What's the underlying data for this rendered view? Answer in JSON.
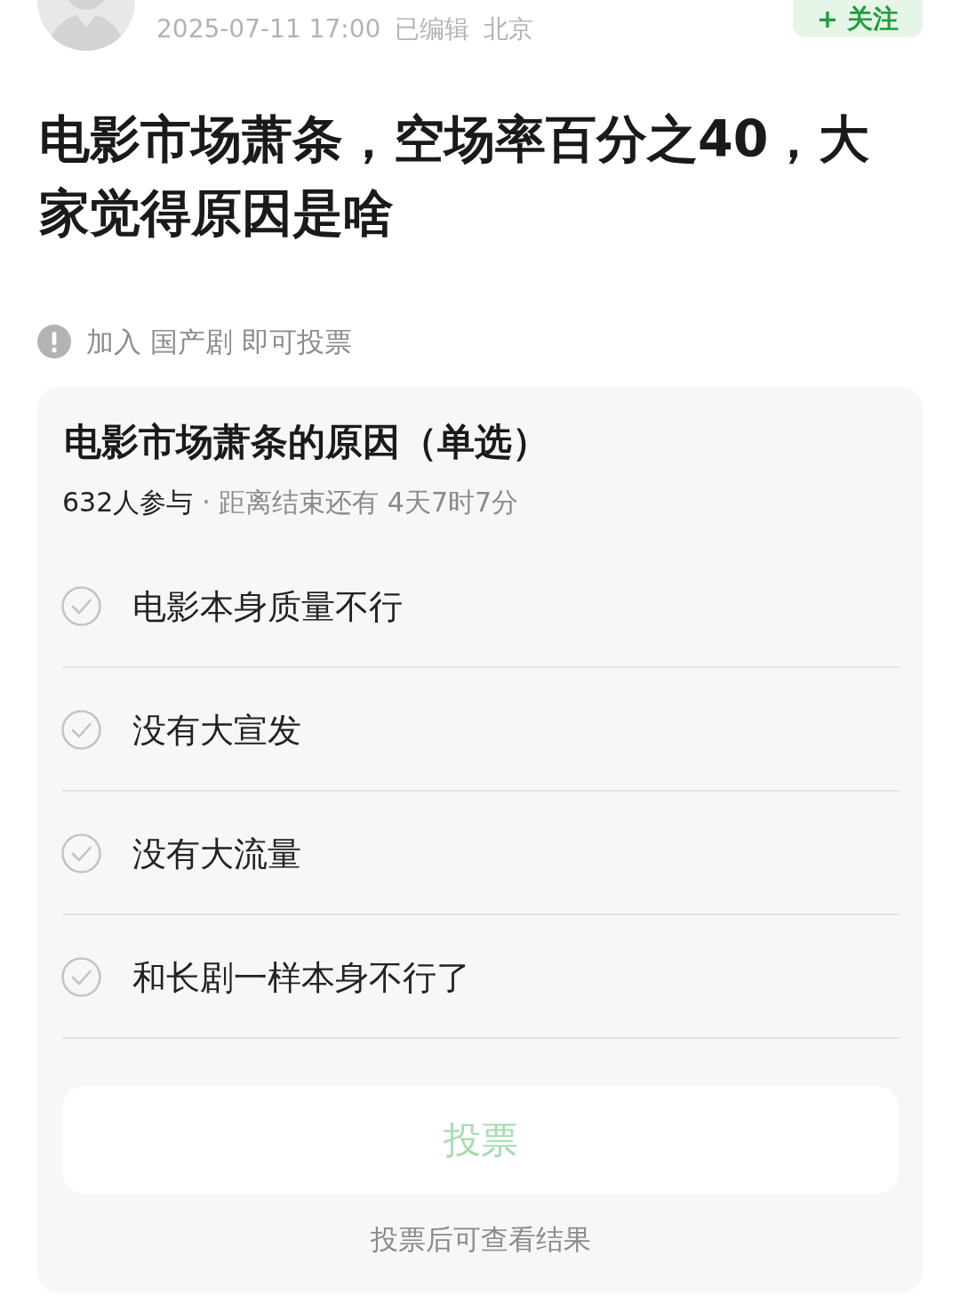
{
  "header": {
    "timestamp": "2025-07-11 17:00",
    "edited": "已编辑",
    "location": "北京",
    "follow_button": "+ 关注"
  },
  "title": "电影市场萧条，空场率百分之40，大家觉得原因是啥",
  "notice": "加入 国产剧 即可投票",
  "poll": {
    "title": "电影市场萧条的原因（单选）",
    "participants": "632人参与",
    "countdown": "· 距离结束还有 4天7时7分",
    "options": [
      {
        "label": "电影本身质量不行",
        "selected": false
      },
      {
        "label": "没有大宣发",
        "selected": false
      },
      {
        "label": "没有大流量",
        "selected": false
      },
      {
        "label": "和长剧一样本身不行了",
        "selected": false
      }
    ],
    "vote_button": {
      "label": "投票",
      "disabled": true
    },
    "footer": "投票后可查看结果"
  }
}
